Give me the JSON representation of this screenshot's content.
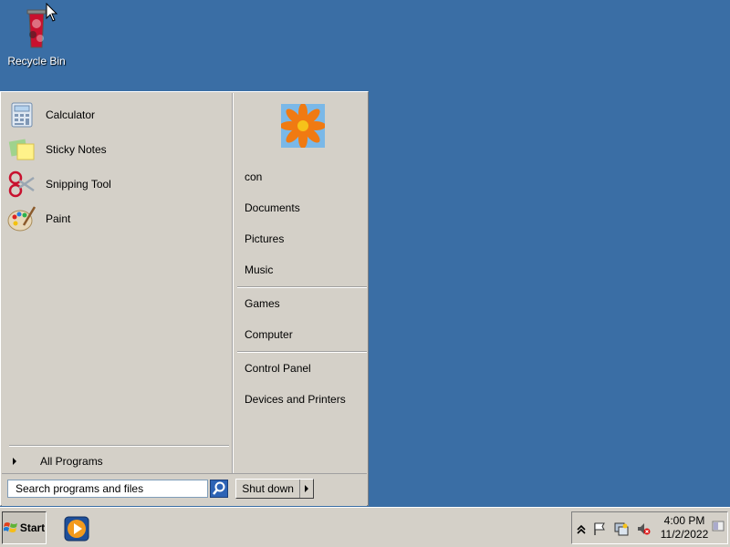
{
  "desktop": {
    "icons": [
      {
        "label": "Recycle Bin",
        "icon": "recycle-bin-icon"
      }
    ]
  },
  "start_menu": {
    "programs": [
      {
        "label": "Calculator",
        "icon": "calculator-icon"
      },
      {
        "label": "Sticky Notes",
        "icon": "sticky-notes-icon"
      },
      {
        "label": "Snipping Tool",
        "icon": "scissors-icon"
      },
      {
        "label": "Paint",
        "icon": "paint-palette-icon"
      }
    ],
    "all_programs": "All Programs",
    "places": [
      "con",
      "Documents",
      "Pictures",
      "Music",
      "Games",
      "Computer",
      "Control Panel",
      "Devices and Printers"
    ],
    "search_placeholder": "Search programs and files",
    "shutdown_label": "Shut down"
  },
  "taskbar": {
    "start_label": "Start",
    "pinned_app_icon": "media-player-icon",
    "tray_icons": [
      "show-hidden-icons-chevron-icon",
      "action-center-flag-icon",
      "network-icon",
      "volume-muted-icon"
    ],
    "clock_time": "4:00 PM",
    "clock_date": "11/2/2022"
  },
  "colors": {
    "desktop": "#3a6ea5",
    "menu": "#d4d0c8"
  }
}
